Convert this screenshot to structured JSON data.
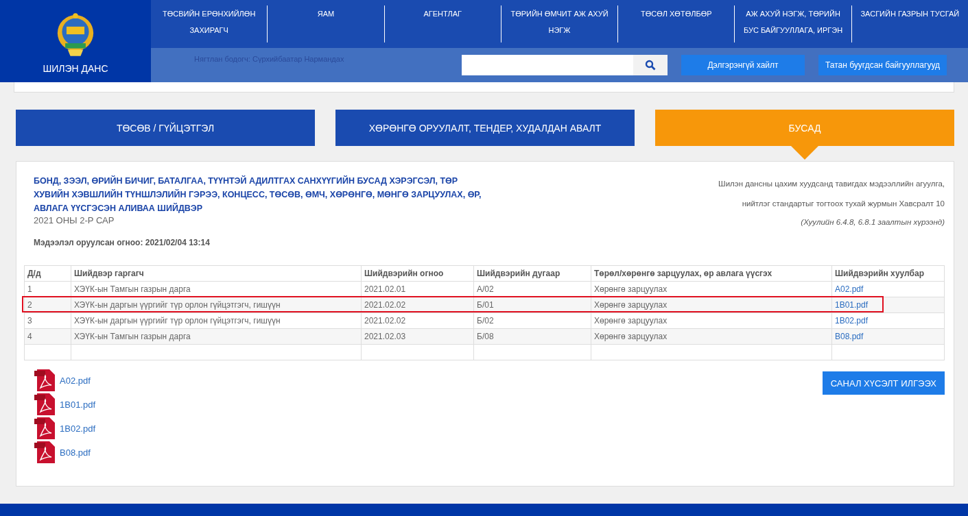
{
  "header": {
    "logo_text": "ШИЛЭН ДАНС",
    "background_line": "Нягтлан бодогч: Сүрхийбаатар Нармандах",
    "nav": [
      {
        "label": "ТӨСВИЙН ЕРӨНХИЙЛӨН ЗАХИРАГЧ"
      },
      {
        "label": "ЯАМ"
      },
      {
        "label": "АГЕНТЛАГ"
      },
      {
        "label": "ТӨРИЙН ӨМЧИТ АЖ АХУЙ НЭГЖ"
      },
      {
        "label": "ТӨСӨЛ ХӨТӨЛБӨР"
      },
      {
        "label": "АЖ АХУЙ НЭГЖ, ТӨРИЙН БУС БАЙГУУЛЛАГА, ИРГЭН"
      },
      {
        "label": "ЗАСГИЙН ГАЗРЫН ТУСГАЙ"
      }
    ],
    "buttons": [
      "Дэлгэрэнгүй хайлт",
      "Татан буугдсан байгууллагууд"
    ]
  },
  "tabs": [
    {
      "label": "ТӨСӨВ / ГҮЙЦЭТГЭЛ",
      "selected": false
    },
    {
      "label": "ХӨРӨНГӨ ОРУУЛАЛТ, ТЕНДЕР, ХУДАЛДАН АВАЛТ",
      "selected": false
    },
    {
      "label": "БУСАД",
      "selected": true
    }
  ],
  "report": {
    "title": "БОНД, ЗЭЭЛ, ӨРИЙН БИЧИГ, БАТАЛГАА, ТҮҮНТЭЙ АДИЛТГАХ САНХҮҮГИЙН БУСАД ХЭРЭГСЭЛ, ТӨР ХУВИЙН ХЭВШЛИЙН ТҮНШЛЭЛИЙН ГЭРЭЭ, КОНЦЕСС, ТӨСӨВ, ӨМЧ, ХӨРӨНГӨ, МӨНГӨ ЗАРЦУУЛАХ, ӨР, АВЛАГА ҮҮСГЭСЭН АЛИВАА ШИЙДВЭР",
    "period": "2021 ОНЫ 2-Р САР",
    "updated": "Мэдээлэл оруулсан огноо: 2021/02/04 13:14",
    "note": [
      "Шилэн дансны цахим хуудсанд тавигдах мэдээллийн агуулга,",
      "нийтлэг стандартыг тогтоох тухай журмын Хавсралт 10",
      "(Хуулийн 6.4.8, 6.8.1 заалтын хүрээнд)"
    ]
  },
  "table": {
    "columns": [
      "Д/д",
      "Шийдвэр гаргагч",
      "Шийдвэрийн огноо",
      "Шийдвэрийн дугаар",
      "Төрөл/хөрөнгө зарцуулах, өр авлага үүсгэх",
      "Шийдвэрийн хуулбар"
    ],
    "rows": [
      {
        "cells": [
          "1",
          "ХЭҮК-ын Тамгын газрын дарга",
          "2021.02.01",
          "А/02",
          "Хөрөнгө зарцуулах"
        ],
        "file": "A02.pdf",
        "highlighted": false
      },
      {
        "cells": [
          "2",
          "ХЭҮК-ын даргын үүргийг түр орлон гүйцэтгэгч, гишүүн",
          "2021.02.02",
          "Б/01",
          "Хөрөнгө зарцуулах"
        ],
        "file": "1B01.pdf",
        "highlighted": true
      },
      {
        "cells": [
          "3",
          "ХЭҮК-ын даргын үүргийг түр орлон гүйцэтгэгч, гишүүн",
          "2021.02.02",
          "Б/02",
          "Хөрөнгө зарцуулах"
        ],
        "file": "1B02.pdf",
        "highlighted": false
      },
      {
        "cells": [
          "4",
          "ХЭҮК-ын Тамгын газрын дарга",
          "2021.02.03",
          "Б/08",
          "Хөрөнгө зарцуулах"
        ],
        "file": "B08.pdf",
        "highlighted": false
      }
    ]
  },
  "attachments": [
    "A02.pdf",
    "1B01.pdf",
    "1B02.pdf",
    "B08.pdf"
  ],
  "feedback_button": "САНАЛ ХҮСЭЛТ ИЛГЭЭХ"
}
